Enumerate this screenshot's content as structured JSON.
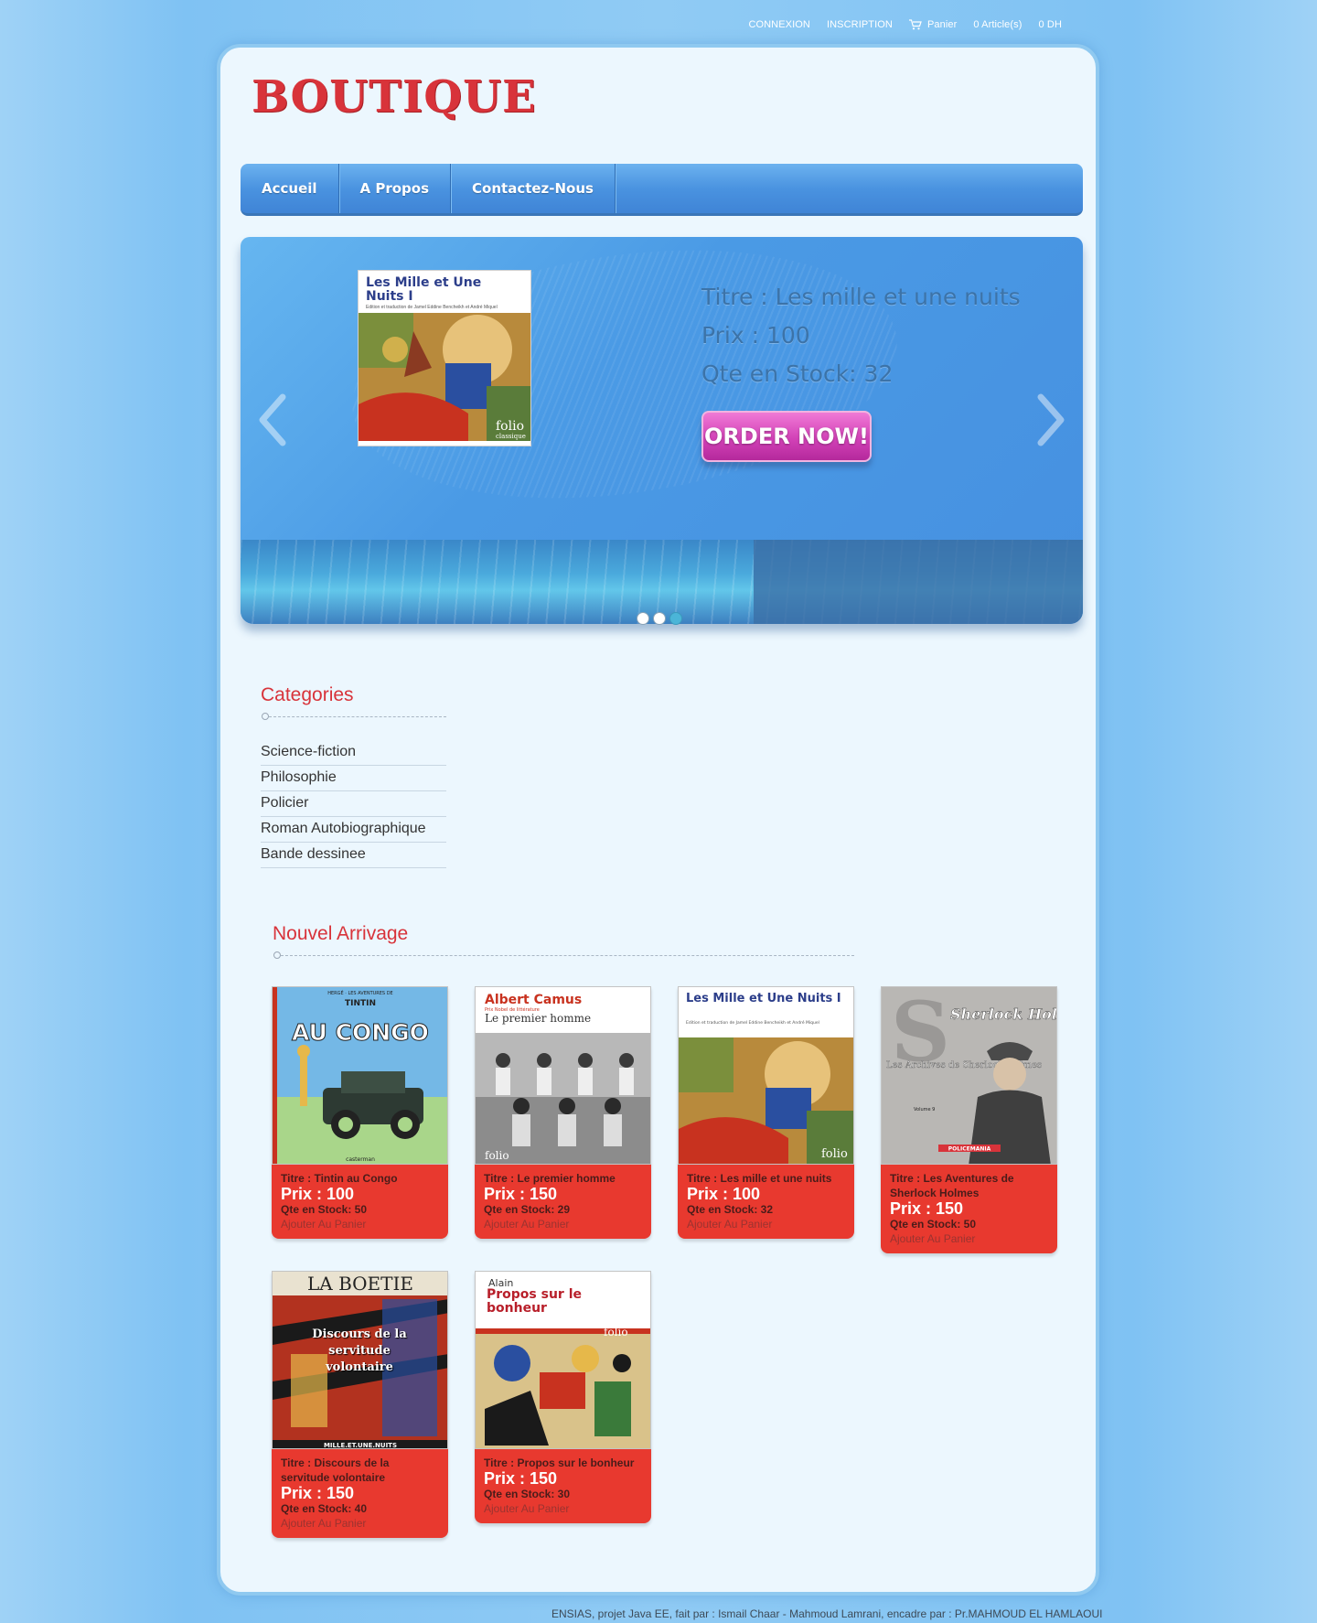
{
  "topbar": {
    "login": "CONNEXION",
    "register": "INSCRIPTION",
    "cart_label": "Panier",
    "cart_count": "0 Article(s)",
    "cart_total": "0 DH"
  },
  "logo": "BOUTIQUE",
  "nav": {
    "items": [
      "Accueil",
      "A Propos",
      "Contactez-Nous"
    ]
  },
  "slider": {
    "cover_title": "Les Mille et Une Nuits I",
    "cover_sub": "Edition et traduction de Jamel Eddine Bencheikh et André Miquel",
    "cover_brand": "folio",
    "cover_series": "classique",
    "title": "Titre : Les mille et une nuits",
    "price": "Prix : 100",
    "stock": "Qte en Stock: 32",
    "order_label": "ORDER NOW!",
    "active_dot": 2
  },
  "categories": {
    "title": "Categories",
    "items": [
      "Science-fiction",
      "Philosophie",
      "Policier",
      "Roman Autobiographique",
      "Bande dessinee"
    ]
  },
  "arrivals": {
    "title": "Nouvel Arrivage",
    "add_label": "Ajouter Au Panier",
    "books": [
      {
        "title": "Titre : Tintin au Congo",
        "price": "Prix : 100",
        "stock": "Qte en Stock: 50",
        "cover_top": "TINTIN",
        "cover_main": "AU CONGO",
        "cover_small": "HERGÉ · LES AVENTURES DE",
        "publisher": "casterman"
      },
      {
        "title": "Titre : Le premier homme",
        "price": "Prix : 150",
        "stock": "Qte en Stock: 29",
        "cover_top": "Albert Camus",
        "cover_main": "Le premier homme",
        "cover_small": "Prix Nobel de littérature",
        "publisher": "folio"
      },
      {
        "title": "Titre : Les mille et une nuits",
        "price": "Prix : 100",
        "stock": "Qte en Stock: 32",
        "cover_top": "Les Mille et Une Nuits I",
        "cover_main": "",
        "cover_small": "Edition et traduction de Jamel Eddine Bencheikh et André Miquel",
        "publisher": "folio"
      },
      {
        "title": "Titre : Les Aventures de Sherlock Holmes",
        "price": "Prix : 150",
        "stock": "Qte en Stock: 50",
        "cover_top": "Sherlock Holmes",
        "cover_main": "Les Archives de Sherlock Holmes",
        "cover_small": "Volume 9",
        "publisher": "POLICEMANIA"
      },
      {
        "title": "Titre : Discours de la servitude volontaire",
        "price": "Prix : 150",
        "stock": "Qte en Stock: 40",
        "cover_top": "LA BOETIE",
        "cover_main": "Discours de la servitude volontaire",
        "cover_small": "",
        "publisher": "MILLE.ET.UNE.NUITS"
      },
      {
        "title": "Titre : Propos sur le bonheur",
        "price": "Prix : 150",
        "stock": "Qte en Stock: 30",
        "cover_top": "Alain",
        "cover_main": "Propos sur le bonheur",
        "cover_small": "",
        "publisher": "folio"
      }
    ]
  },
  "footer": "ENSIAS, projet Java EE, fait par : Ismail Chaar - Mahmoud Lamrani, encadre par : Pr.MAHMOUD EL HAMLAOUI",
  "colors": {
    "accent_red": "#d8333a",
    "card_red": "#e8392f",
    "nav_blue": "#4a93e0",
    "order_pink": "#d241b7",
    "page_bg": "#ecf7fe"
  }
}
